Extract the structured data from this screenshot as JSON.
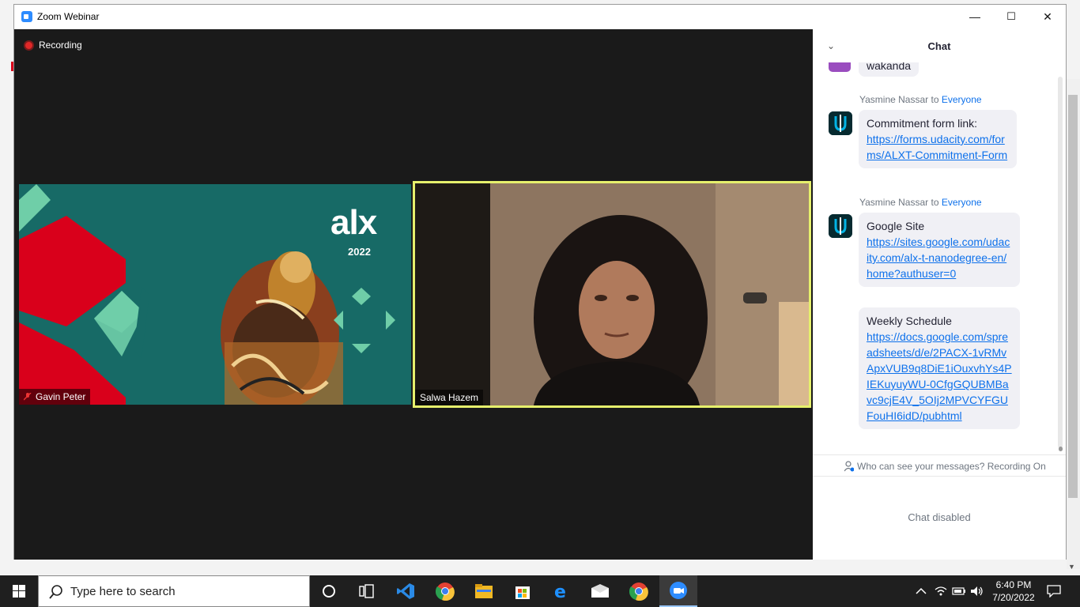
{
  "window": {
    "title": "Zoom Webinar",
    "minimize": "—",
    "maximize": "☐",
    "close": "✕"
  },
  "recording": {
    "label": "Recording"
  },
  "participants": [
    {
      "name": "Gavin Peter",
      "muted": true
    },
    {
      "name": "Salwa Hazem",
      "active_speaker": true
    }
  ],
  "shared_slide": {
    "logo": "alx",
    "year": "2022"
  },
  "chat": {
    "title": "Chat",
    "partial_message": "wakanda",
    "messages": [
      {
        "sender": "Yasmine Nassar",
        "to_word": "to",
        "target": "Everyone",
        "text": "Commitment form link:",
        "link": "https://forms.udacity.com/forms/ALXT-Commitment-Form"
      },
      {
        "sender": "Yasmine Nassar",
        "to_word": "to",
        "target": "Everyone",
        "text": "Google Site",
        "link": "https://sites.google.com/udacity.com/alx-t-nanodegree-en/home?authuser=0",
        "text2": "Weekly Schedule",
        "link2": "https://docs.google.com/spreadsheets/d/e/2PACX-1vRMvApxVUB9q8DiE1iOuxvhYs4PIEKuyuyWU-0CfgGQUBMBavc9cjE4V_5OIj2MPVCYFGUFouHI6idD/pubhtml"
      }
    ],
    "privacy_note": "Who can see your messages? Recording On",
    "disabled_note": "Chat disabled"
  },
  "taskbar": {
    "search_placeholder": "Type here to search",
    "time": "6:40 PM",
    "date": "7/20/2022",
    "apps": [
      "cortana-icon",
      "task-view-icon",
      "vscode-icon",
      "chrome-icon",
      "file-explorer-icon",
      "microsoft-store-icon",
      "edge-icon",
      "mail-icon",
      "chrome-icon",
      "zoom-icon"
    ]
  },
  "colors": {
    "zoom_blue": "#2d8cff",
    "link_blue": "#0e71eb",
    "active_speaker_border": "#e6f06c",
    "alx_teal": "#176a66",
    "alx_red": "#d9001b",
    "alx_mint": "#6fcea8"
  }
}
